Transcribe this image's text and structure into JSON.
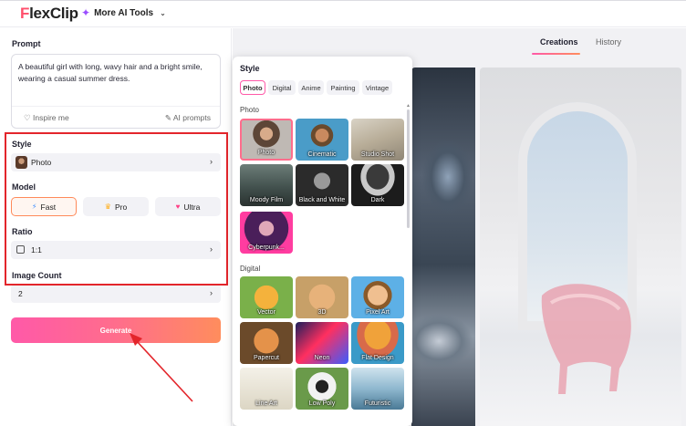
{
  "app": {
    "logo": "FlexClip",
    "ai_tools_label": "More AI Tools"
  },
  "left": {
    "prompt_label": "Prompt",
    "prompt_value": "A beautiful girl with long, wavy hair and a bright smile, wearing a casual summer dress.",
    "inspire_label": "Inspire me",
    "ai_prompts_label": "AI prompts",
    "style_label": "Style",
    "style_value": "Photo",
    "model_label": "Model",
    "models": [
      "Fast",
      "Pro",
      "Ultra"
    ],
    "selected_model": "Fast",
    "ratio_label": "Ratio",
    "ratio_value": "1:1",
    "image_count_label": "Image Count",
    "image_count_value": "2",
    "generate_label": "Generate"
  },
  "tabs": [
    "Creations",
    "History"
  ],
  "active_tab": "Creations",
  "style_popup": {
    "title": "Style",
    "chips": [
      "Photo",
      "Digital",
      "Anime",
      "Painting",
      "Vintage"
    ],
    "active_chip": "Photo",
    "photo_label": "Photo",
    "photo_styles": [
      "Photo",
      "Cinematic",
      "Studio Shot",
      "Moody Film",
      "Black and White",
      "Dark",
      "Cyberpunk..."
    ],
    "digital_label": "Digital",
    "digital_styles": [
      "Vector",
      "3D",
      "Pixel Art",
      "Papercut",
      "Neon",
      "Flat Design",
      "Line Art",
      "Low Poly",
      "Futuristic"
    ]
  },
  "colors": {
    "accent_start": "#ff59a8",
    "accent_end": "#ff8d5d",
    "highlight_box": "#e3252b"
  }
}
